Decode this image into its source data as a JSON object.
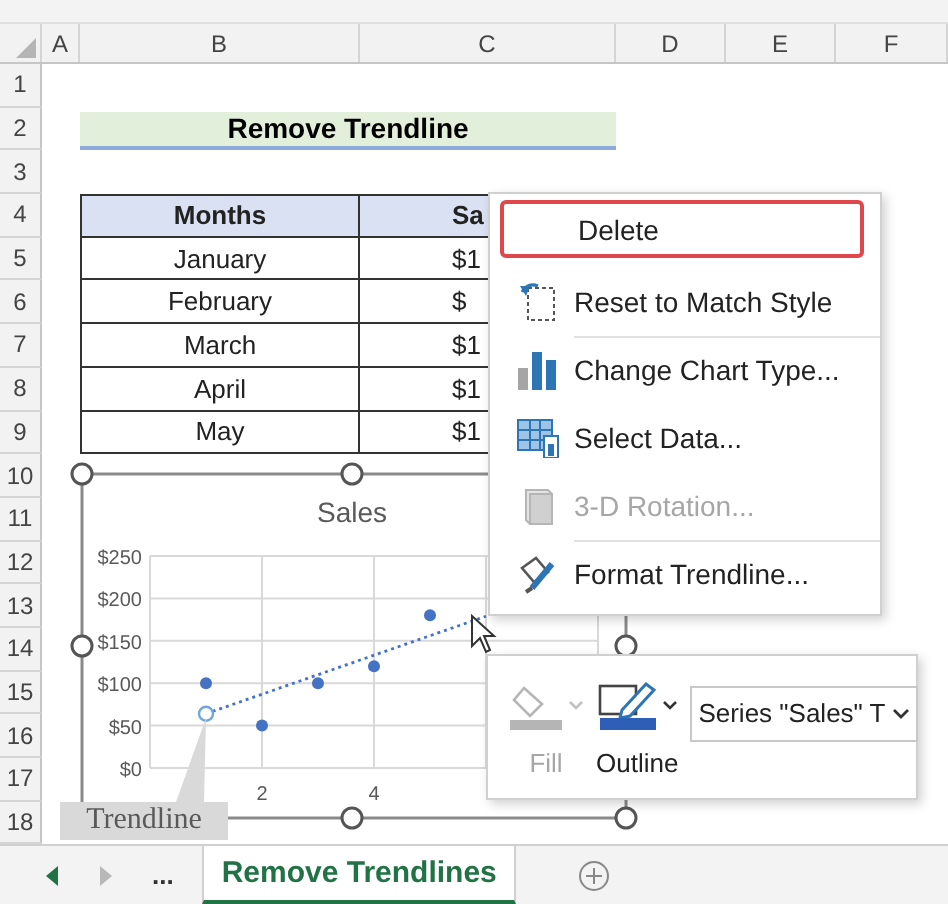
{
  "columns": [
    "A",
    "B",
    "C",
    "D",
    "E",
    "F"
  ],
  "rows": [
    "1",
    "2",
    "3",
    "4",
    "5",
    "6",
    "7",
    "8",
    "9",
    "10",
    "11",
    "12",
    "13",
    "14",
    "15",
    "16",
    "17",
    "18"
  ],
  "title_cell": "Remove Trendline",
  "table": {
    "columns": [
      "Months",
      "Sa"
    ],
    "rows": [
      [
        "January",
        "$1"
      ],
      [
        "February",
        "$"
      ],
      [
        "March",
        "$1"
      ],
      [
        "April",
        "$1"
      ],
      [
        "May",
        "$1"
      ]
    ]
  },
  "chart": {
    "selected": true,
    "tooltip": "Trendline",
    "trendline": {
      "selected": true
    },
    "chart_data": {
      "type": "scatter",
      "title": "Sales",
      "grid": true,
      "x": [
        1,
        2,
        3,
        4,
        5
      ],
      "values": [
        100,
        50,
        100,
        120,
        180
      ],
      "xlim": [
        0,
        8
      ],
      "ylim": [
        0,
        250
      ],
      "xticks": [
        2,
        4
      ],
      "yticks": [
        {
          "value": 0,
          "label": "$0"
        },
        {
          "value": 50,
          "label": "$50"
        },
        {
          "value": 100,
          "label": "$100"
        },
        {
          "value": 150,
          "label": "$150"
        },
        {
          "value": 200,
          "label": "$200"
        },
        {
          "value": 250,
          "label": "$250"
        }
      ]
    }
  },
  "context_menu": {
    "items": [
      {
        "kind": "delete",
        "label": "Delete",
        "highlighted": true,
        "disabled": false,
        "separator_before": false
      },
      {
        "kind": "reset",
        "label": "Reset to Match Style",
        "highlighted": false,
        "disabled": false,
        "separator_before": false
      },
      {
        "kind": "chart-type",
        "label": "Change Chart Type...",
        "highlighted": false,
        "disabled": false,
        "separator_before": true
      },
      {
        "kind": "select-data",
        "label": "Select Data...",
        "highlighted": false,
        "disabled": false,
        "separator_before": false
      },
      {
        "kind": "rotation",
        "label": "3-D Rotation...",
        "highlighted": false,
        "disabled": true,
        "separator_before": false
      },
      {
        "kind": "format",
        "label": "Format Trendline...",
        "highlighted": false,
        "disabled": false,
        "separator_before": true
      }
    ]
  },
  "mini_toolbar": {
    "buttons": [
      {
        "kind": "fill",
        "label": "Fill",
        "disabled": true
      },
      {
        "kind": "outline",
        "label": "Outline",
        "disabled": false
      }
    ],
    "dropdown": "Series \"Sales\" T"
  },
  "sheet_tabs": {
    "more": "...",
    "tabs": [
      {
        "label": "Remove Trendlines",
        "selected": true
      }
    ]
  }
}
